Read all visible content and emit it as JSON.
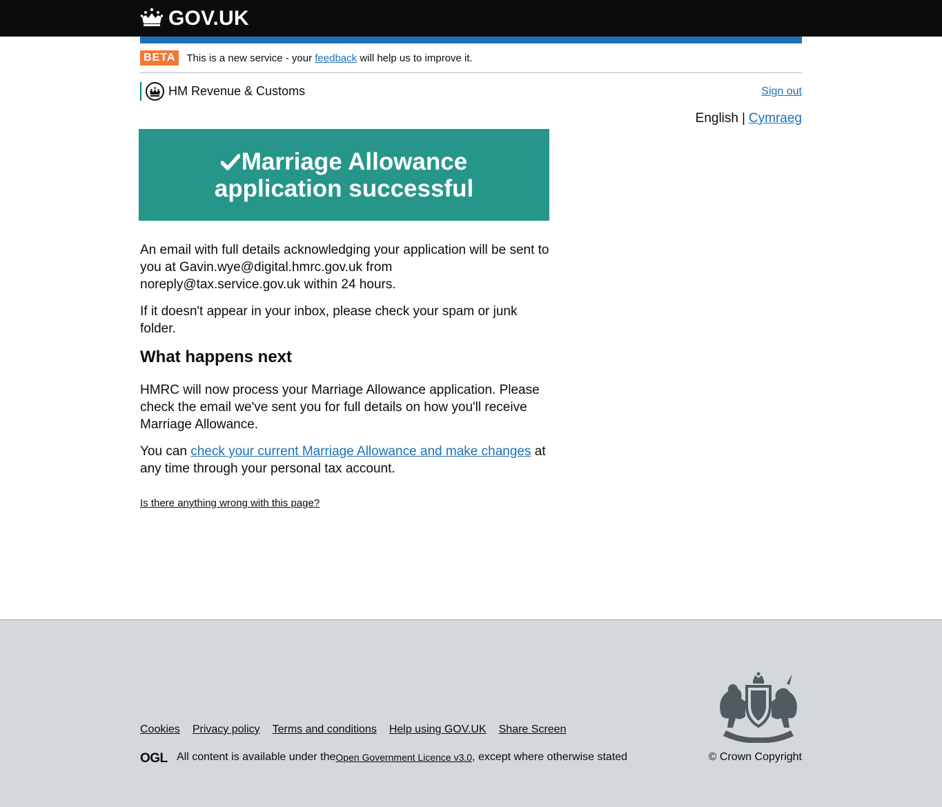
{
  "header": {
    "logo_text": "GOV.UK"
  },
  "phase_banner": {
    "tag": "BETA",
    "text_before": "This is a new service - your ",
    "link": "feedback",
    "text_after": " will help us to improve it."
  },
  "service": {
    "department": "HM Revenue & Customs",
    "sign_out": "Sign out"
  },
  "language": {
    "current": "English",
    "separator": "|",
    "other": "Cymraeg"
  },
  "confirmation": {
    "title_line1": "Marriage Allowance",
    "title_line2": "application successful"
  },
  "content": {
    "para1": "An email with full details acknowledging your application will be sent to you at Gavin.wye@digital.hmrc.gov.uk from noreply@tax.service.gov.uk within 24 hours.",
    "para2": "If it doesn't appear in your inbox, please check your spam or junk folder.",
    "heading": "What happens next",
    "para3": "HMRC will now process your Marriage Allowance application. Please check the email we've sent you for full details on how you'll receive Marriage Allowance.",
    "para4_before": "You can ",
    "para4_link": "check your current Marriage Allowance and make changes",
    "para4_after": " at any time through your personal tax account."
  },
  "report_link": "Is there anything wrong with this page?",
  "footer": {
    "links": [
      "Cookies",
      "Privacy policy",
      "Terms and conditions",
      "Help using GOV.UK",
      "Share Screen"
    ],
    "ogl_label": "OGL",
    "licence_before": "All content is available under the ",
    "licence_link": "Open Government Licence v3.0",
    "licence_after": ", except where otherwise stated",
    "copyright": "© Crown Copyright"
  },
  "colors": {
    "header_bg": "#0b0c0c",
    "accent_blue": "#1d70b8",
    "beta_orange": "#f47738",
    "panel_green": "#26968a",
    "hmrc_teal": "#00847a",
    "footer_bg": "#d3d8dc"
  },
  "icons": [
    "crown-icon",
    "hmrc-crest-icon",
    "tick-icon",
    "ogl-logo-icon",
    "royal-coat-of-arms-icon"
  ]
}
